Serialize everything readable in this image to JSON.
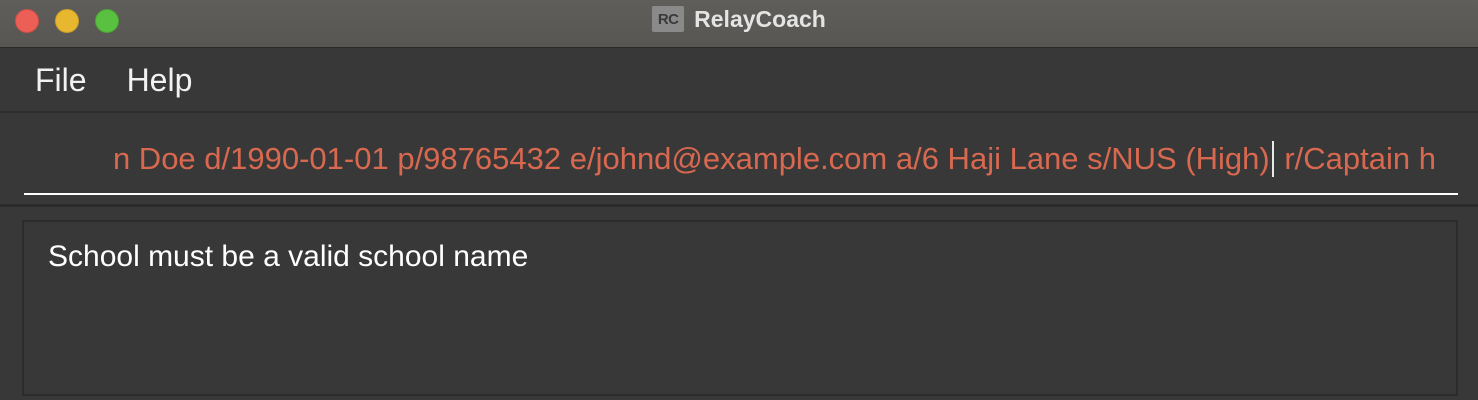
{
  "window": {
    "title": "RelayCoach",
    "app_icon_text": "RC",
    "traffic_lights": {
      "close_color": "#ec5f57",
      "minimize_color": "#e8b730",
      "maximize_color": "#5ac140"
    }
  },
  "menubar": {
    "items": [
      {
        "label": "File"
      },
      {
        "label": "Help"
      }
    ]
  },
  "command_box": {
    "text_before_caret": "n Doe d/1990-01-01 p/98765432 e/johnd@example.com a/6 Haji Lane s/NUS (High)",
    "text_after_caret": " r/Captain h",
    "text_color": "#d8684f"
  },
  "result_display": {
    "message": "School must be a valid school name"
  }
}
